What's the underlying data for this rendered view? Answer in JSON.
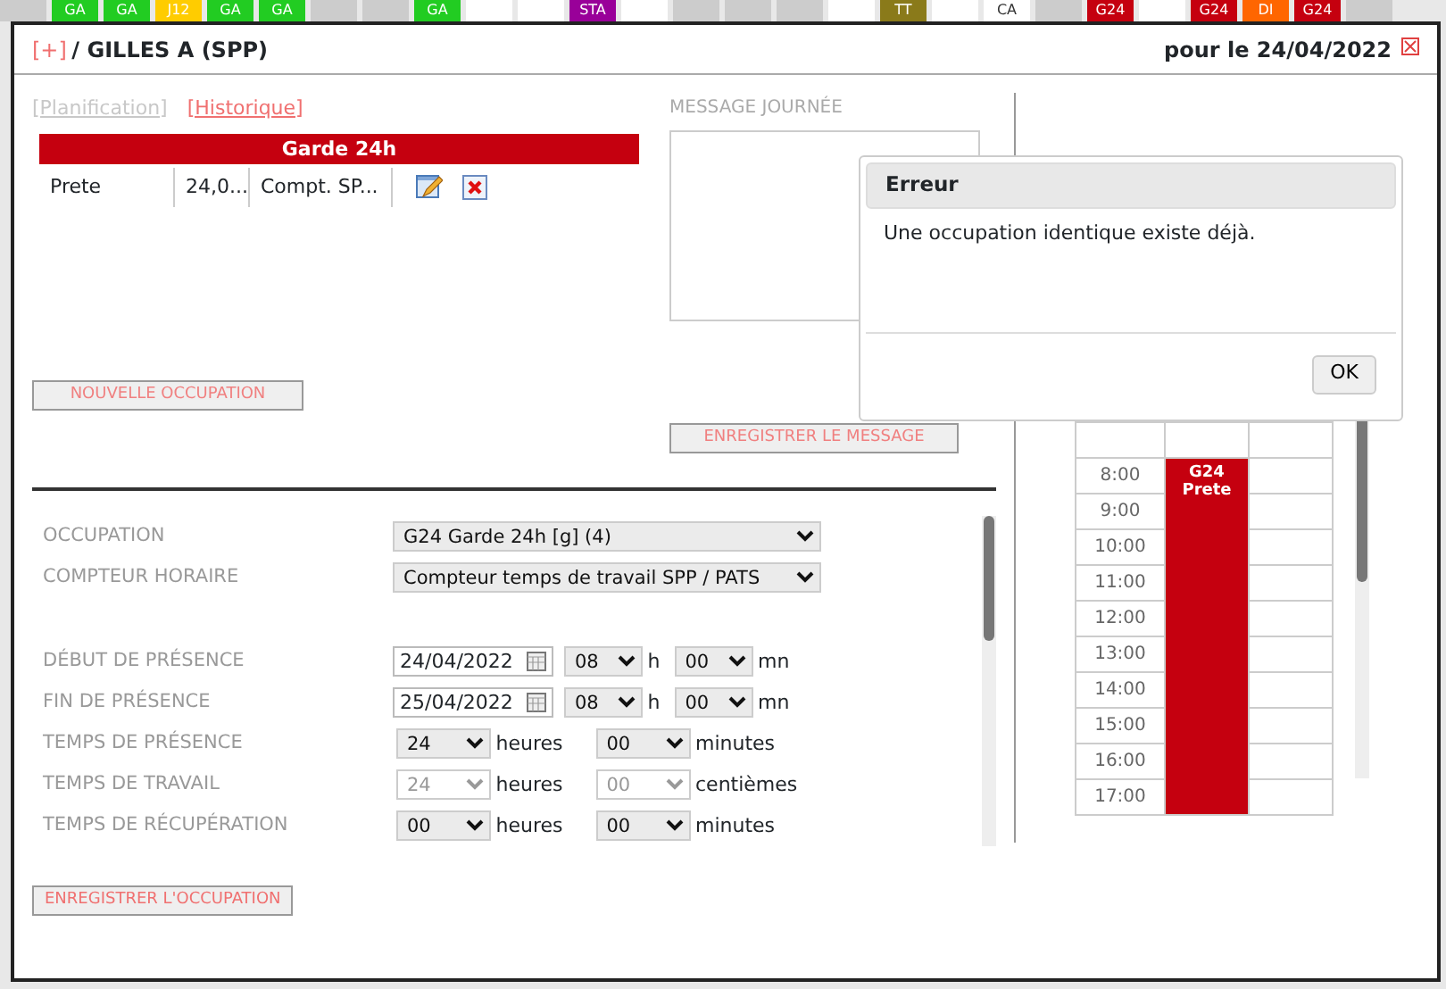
{
  "background_schedule": {
    "cells": [
      {
        "color": "#cccccc"
      },
      {
        "label": "GA",
        "color": "#22cc22"
      },
      {
        "label": "GA",
        "color": "#22cc22"
      },
      {
        "label": "J12",
        "color": "#ffcc00"
      },
      {
        "label": "GA",
        "color": "#22cc22"
      },
      {
        "label": "GA",
        "color": "#22cc22"
      },
      {
        "color": "#cccccc"
      },
      {
        "color": "#cccccc"
      },
      {
        "label": "GA",
        "color": "#22cc22"
      },
      {
        "color": "#ffffff"
      },
      {
        "color": "#ffffff"
      },
      {
        "label": "STA",
        "color": "#990099"
      },
      {
        "color": "#ffffff"
      },
      {
        "color": "#cccccc"
      },
      {
        "color": "#cccccc"
      },
      {
        "color": "#cccccc"
      },
      {
        "color": "#ffffff"
      },
      {
        "label": "TT",
        "color": "#8a7a1a"
      },
      {
        "color": "#ffffff"
      },
      {
        "label": "CA",
        "color": "#ffffff"
      },
      {
        "color": "#cccccc"
      },
      {
        "label": "G24",
        "color": "#c5000f"
      },
      {
        "color": "#ffffff"
      },
      {
        "label": "G24",
        "color": "#c5000f"
      },
      {
        "label": "DI",
        "color": "#ff6600"
      },
      {
        "label": "G24",
        "color": "#c5000f"
      },
      {
        "color": "#cccccc"
      }
    ]
  },
  "dialog": {
    "expand_link": "[+]",
    "title": "/ GILLES A (SPP)",
    "date": "pour le 24/04/2022"
  },
  "links": [
    {
      "label": "[Planification]",
      "disabled": true
    },
    {
      "label": "[Historique]",
      "disabled": false
    }
  ],
  "occupations_table": {
    "header": "Garde 24h",
    "rows": [
      {
        "cells": [
          "Prete",
          "24,0...",
          "Compt. SP..."
        ]
      }
    ]
  },
  "message": {
    "label": "MESSAGE JOURNÉE"
  },
  "buttons": {
    "new_occupation": "NOUVELLE OCCUPATION",
    "save_message": "ENREGISTRER LE MESSAGE",
    "save_occupation": "ENREGISTRER L'OCCUPATION"
  },
  "form": [
    {
      "kind": "select",
      "label": "OCCUPATION",
      "value": "G24 Garde 24h [g] (4)"
    },
    {
      "kind": "select",
      "label": "COMPTEUR HORAIRE",
      "value": "Compteur temps de travail SPP / PATS"
    },
    {
      "kind": "spacer"
    },
    {
      "kind": "datetime",
      "label": "DÉBUT DE PRÉSENCE",
      "date": "24/04/2022",
      "hour": "08",
      "hour_unit": "h",
      "minute": "00",
      "minute_unit": "mn"
    },
    {
      "kind": "datetime",
      "label": "FIN DE PRÉSENCE",
      "date": "25/04/2022",
      "hour": "08",
      "hour_unit": "h",
      "minute": "00",
      "minute_unit": "mn"
    },
    {
      "kind": "duration",
      "label": "TEMPS DE PRÉSENCE",
      "disabled": false,
      "hours": "24",
      "hours_unit": "heures",
      "minutes": "00",
      "minutes_unit": "minutes"
    },
    {
      "kind": "duration",
      "label": "TEMPS DE TRAVAIL",
      "disabled": true,
      "hours": "24",
      "hours_unit": "heures",
      "minutes": "00",
      "minutes_unit": "centièmes"
    },
    {
      "kind": "duration",
      "label": "TEMPS DE RÉCUPÉRATION",
      "disabled": false,
      "hours": "00",
      "hours_unit": "heures",
      "minutes": "00",
      "minutes_unit": "minutes"
    }
  ],
  "calendar": {
    "hours": [
      "8:00",
      "9:00",
      "10:00",
      "11:00",
      "12:00",
      "13:00",
      "14:00",
      "15:00",
      "16:00",
      "17:00"
    ],
    "event": {
      "code": "G24",
      "status": "Prete",
      "color": "#c5000f"
    }
  },
  "error_dialog": {
    "title": "Erreur",
    "message": "Une occupation identique existe déjà.",
    "button": "OK"
  }
}
